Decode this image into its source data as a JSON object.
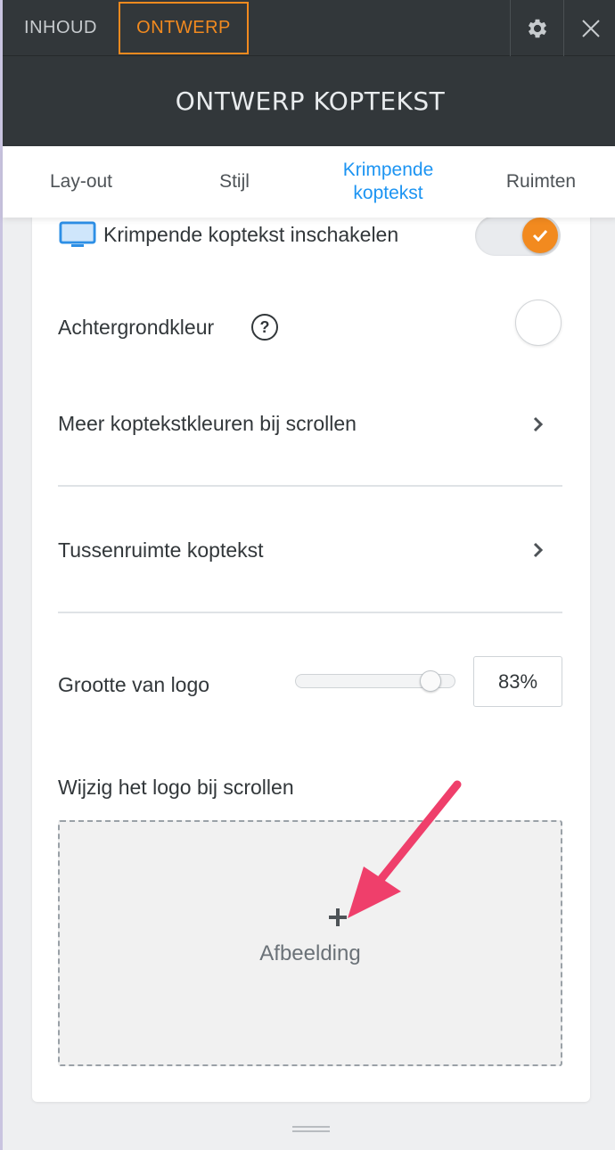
{
  "top_tabs": {
    "content": "INHOUD",
    "design": "ONTWERP"
  },
  "top_icons": {
    "settings": "gear-icon",
    "close": "close-icon"
  },
  "header": {
    "title": "ONTWERP KOPTEKST"
  },
  "sub_tabs": [
    {
      "label": "Lay-out"
    },
    {
      "label": "Stijl"
    },
    {
      "label": "Krimpende koptekst",
      "active": true
    },
    {
      "label": "Ruimten"
    }
  ],
  "settings": {
    "shrink_toggle_label": "Krimpende koptekst inschakelen",
    "shrink_toggle_on": true,
    "background_color_label": "Achtergrondkleur",
    "help_symbol": "?",
    "more_colors_label": "Meer koptekstkleuren bij scrollen",
    "spacing_label": "Tussenruimte koptekst",
    "logo_size_label": "Grootte van logo",
    "logo_size_value": "83%",
    "logo_size_fraction": 0.83,
    "change_logo_label": "Wijzig het logo bij scrollen",
    "add_image_label": "Afbeelding"
  },
  "colors": {
    "accent": "#f28a1f",
    "active_tab": "#1c94f2",
    "topbar": "#32373a",
    "annotation_arrow": "#ef3f6b"
  }
}
